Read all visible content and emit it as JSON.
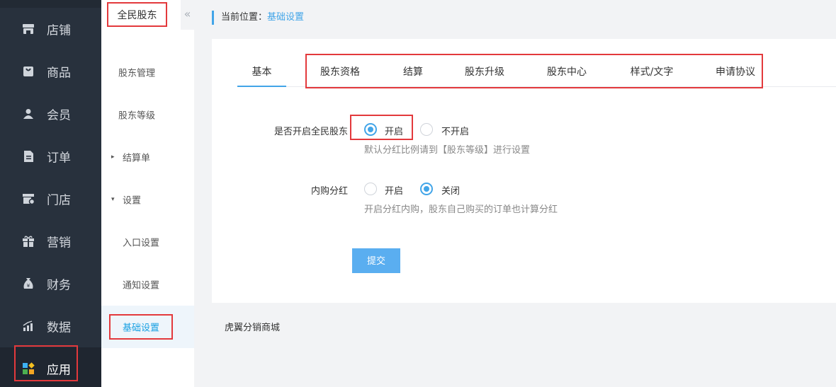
{
  "nav": {
    "items": [
      {
        "label": "店铺",
        "icon": "store-icon"
      },
      {
        "label": "商品",
        "icon": "bag-icon"
      },
      {
        "label": "会员",
        "icon": "user-icon"
      },
      {
        "label": "订单",
        "icon": "order-doc-icon"
      },
      {
        "label": "门店",
        "icon": "shop-gear-icon"
      },
      {
        "label": "营销",
        "icon": "gift-icon"
      },
      {
        "label": "财务",
        "icon": "money-bag-icon"
      },
      {
        "label": "数据",
        "icon": "bar-chart-icon"
      },
      {
        "label": "应用",
        "icon": "apps-grid-icon"
      }
    ],
    "active": "应用"
  },
  "sidebar": {
    "title": "全民股东",
    "collapse_glyph": "«",
    "items": [
      {
        "label": "股东管理"
      },
      {
        "label": "股东等级"
      },
      {
        "label": "结算单",
        "caret": "▸"
      },
      {
        "label": "设置",
        "caret": "▾"
      },
      {
        "label": "入口设置"
      },
      {
        "label": "通知设置"
      },
      {
        "label": "基础设置",
        "active": true
      }
    ]
  },
  "breadcrumb": {
    "prefix": "当前位置：",
    "current": "基础设置"
  },
  "tabs": [
    "基本",
    "股东资格",
    "结算",
    "股东升级",
    "股东中心",
    "样式/文字",
    "申请协议"
  ],
  "active_tab": "基本",
  "form": {
    "enable": {
      "label": "是否开启全民股东",
      "options": [
        "开启",
        "不开启"
      ],
      "selected": "开启",
      "hint": "默认分红比例请到【股东等级】进行设置"
    },
    "internal": {
      "label": "内购分红",
      "options": [
        "开启",
        "关闭"
      ],
      "selected": "关闭",
      "hint": "开启分红内购，股东自己购买的订单也计算分红"
    },
    "submit_label": "提交"
  },
  "footer": "虎翼分销商城",
  "colors": {
    "accent": "#42a5e8",
    "nav_bg": "#28313d",
    "highlight_box": "#e3393c",
    "button": "#5aaef0"
  }
}
